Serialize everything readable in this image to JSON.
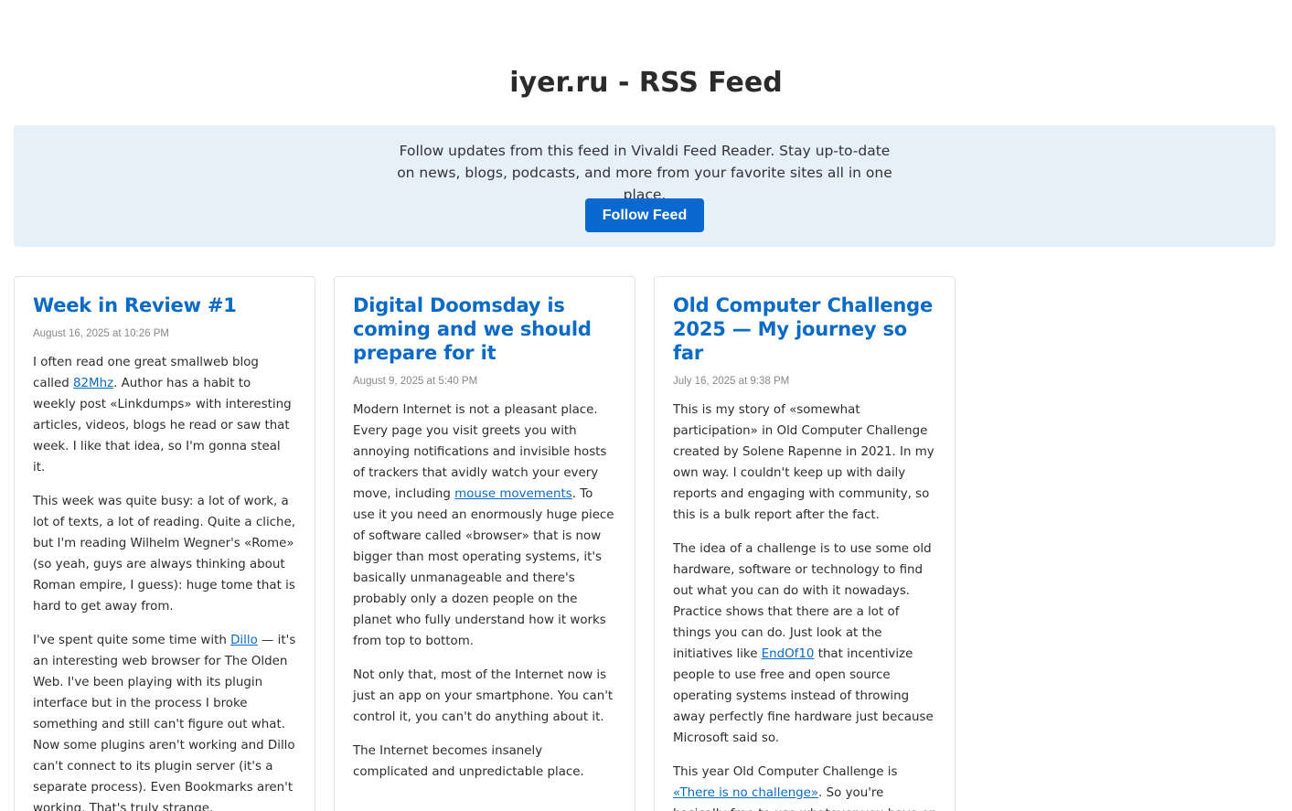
{
  "page": {
    "title": "iyer.ru - RSS Feed"
  },
  "banner": {
    "text": "Follow updates from this feed in Vivaldi Feed Reader. Stay up-to-date on news, blogs, podcasts, and more from your favorite sites all in one place.",
    "button_label": "Follow Feed"
  },
  "colors": {
    "accent": "#0a69d1",
    "banner_bg": "#e6f0f9",
    "link": "#0a6ac8"
  },
  "posts": [
    {
      "title": "Week in Review #1",
      "date": "August 16, 2025 at 10:26 PM",
      "p1": {
        "a": "I often read one great smallweb blog called ",
        "link": "82Mhz",
        "b": ". Author has a habit to weekly post «Linkdumps» with interesting articles, videos, blogs he read or saw that week. I like that idea, so I'm gonna steal it."
      },
      "p2": "This week was quite busy: a lot of work, a lot of texts, a lot of reading. Quite a cliche, but I'm reading Wilhelm Wegner's «Rome» (so yeah, guys are always thinking about Roman empire, I guess): huge tome that is hard to get away from.",
      "p3": {
        "a": "I've spent quite some time with ",
        "link": "Dillo",
        "b": " — it's an interesting web browser for The Olden Web. I've been playing with its plugin interface but in the process I broke something and still can't figure out what. Now some plugins aren't working and Dillo can't connect to its plugin server (it's a separate process). Even Bookmarks aren't working. That's truly strange."
      }
    },
    {
      "title": "Digital Doomsday is coming and we should prepare for it",
      "date": "August 9, 2025 at 5:40 PM",
      "p1": {
        "a": "Modern Internet is not a pleasant place. Every page you visit greets you with annoying notifications and invisible hosts of trackers that avidly watch your every move, including ",
        "link": "mouse movements",
        "b": ". To use it you need an enormously huge piece of software called «browser» that is now bigger than most operating systems, it's basically unmanageable and there's probably only a dozen people on the planet who fully understand how it works from top to bottom."
      },
      "p2": "Not only that, most of the Internet now is just an app on your smartphone. You can't control it, you can't do anything about it.",
      "p3": "The Internet becomes insanely complicated and unpredictable place."
    },
    {
      "title": "Old Computer Challenge 2025 — My journey so far",
      "date": "July 16, 2025 at 9:38 PM",
      "p1": "This is my story of «somewhat participation» in Old Computer Challenge created by Solene Rapenne in 2021. In my own way. I couldn't keep up with daily reports and engaging with community, so this is a bulk report after the fact.",
      "p2": {
        "a": "The idea of a challenge is to use some old hardware, software or technology to find out what you can do with it nowadays. Practice shows that there are a lot of things you can do. Just look at the initiatives like ",
        "link": "EndOf10",
        "b": " that incentivize people to use free and open source operating systems instead of throwing away perfectly fine hardware just because Microsoft said so."
      },
      "p3": {
        "a": "This year Old Computer Challenge is ",
        "link": "«There is no challenge»",
        "b": ". So you're basically free to use whatever you have or want."
      }
    }
  ]
}
